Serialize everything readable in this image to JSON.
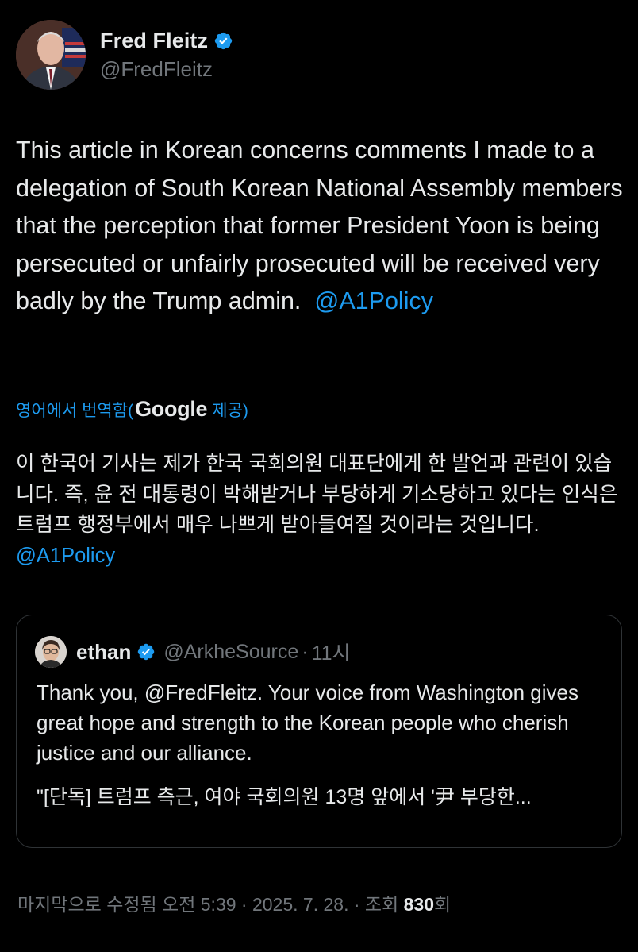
{
  "author": {
    "display_name": "Fred Fleitz",
    "handle": "@FredFleitz"
  },
  "tweet": {
    "text_main": "This article in Korean concerns comments I made to a delegation of South Korean National Assembly members that the perception that former President Yoon is being persecuted or unfairly prosecuted will be received very badly by the Trump admin.",
    "mention": "@A1Policy"
  },
  "translation": {
    "label_prefix": "영어에서 번역함(",
    "provider": "Google",
    "label_suffix": " 제공)",
    "text_main": "이 한국어 기사는 제가 한국 국회의원 대표단에게 한 발언과 관련이 있습니다. 즉, 윤 전 대통령이 박해받거나 부당하게 기소당하고 있다는 인식은 트럼프 행정부에서 매우 나쁘게 받아들여질 것이라는 것입니다.",
    "mention": "@A1Policy"
  },
  "quoted_tweet": {
    "display_name": "ethan",
    "handle": "@ArkheSource",
    "separator": "·",
    "time": "11시",
    "body": "Thank you, @FredFleitz. Your voice from Washington gives great hope and strength to the Korean people who cherish justice and our alliance.",
    "link_preview": "\"[단독] 트럼프 측근, 여야 국회의원 13명 앞에서 '尹 부당한..."
  },
  "meta": {
    "edited_label": "마지막으로 수정됨 오전 5:39 · 2025. 7. 28. · 조회 ",
    "views": "830",
    "views_suffix": "회"
  },
  "colors": {
    "background": "#000000",
    "text": "#e7e9ea",
    "secondary": "#71767b",
    "accent": "#1d9bf0",
    "border": "#2f3336"
  }
}
